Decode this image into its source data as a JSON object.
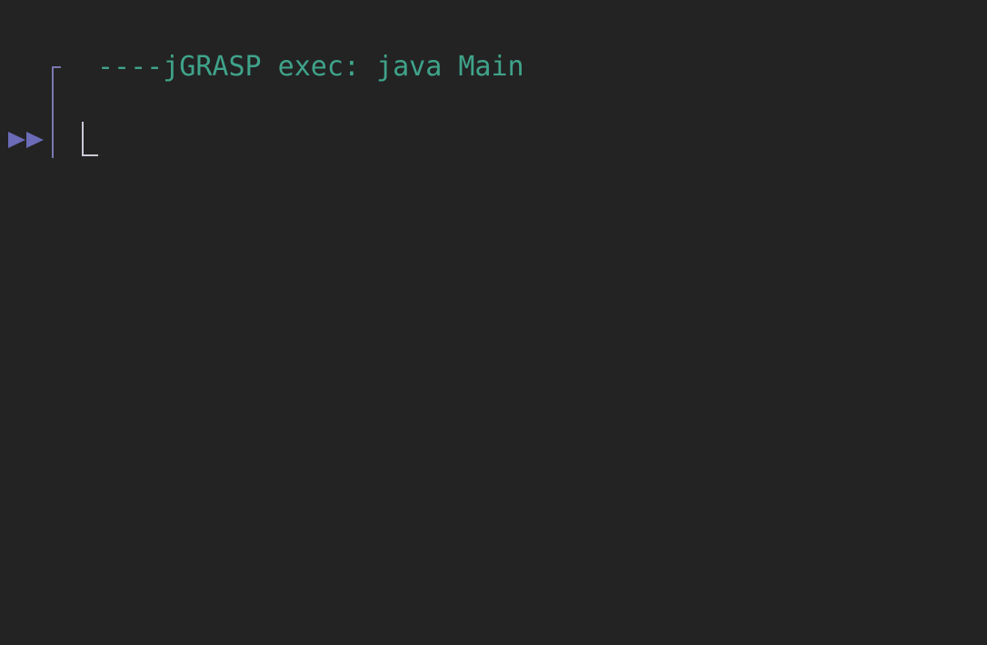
{
  "console": {
    "exec_line": "----jGRASP exec: java Main",
    "input_line": ""
  },
  "icons": {
    "run_marker": "run-arrow-icon",
    "gutter": "output-bracket-icon",
    "cursor": "input-cursor-icon"
  },
  "colors": {
    "background": "#232323",
    "exec_text": "#3fa38a",
    "run_marker": "#6b6bb8",
    "bracket": "#7a78b0",
    "cursor": "#c9c9d6"
  }
}
